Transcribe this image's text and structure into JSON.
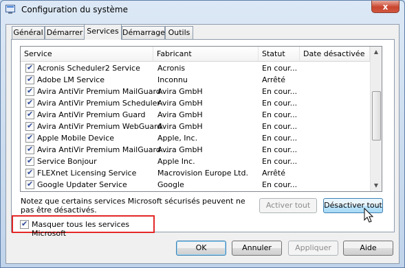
{
  "window": {
    "title": "Configuration du système",
    "close_label": "x"
  },
  "tabs": [
    {
      "label": "Général",
      "active": false
    },
    {
      "label": "Démarrer",
      "active": false
    },
    {
      "label": "Services",
      "active": true
    },
    {
      "label": "Démarrage",
      "active": false
    },
    {
      "label": "Outils",
      "active": false
    }
  ],
  "table": {
    "columns": [
      "Service",
      "Fabricant",
      "Statut",
      "Date désactivée"
    ],
    "rows": [
      {
        "checked": true,
        "service": "Acronis Scheduler2 Service",
        "fabricant": "Acronis",
        "statut": "En cour..."
      },
      {
        "checked": true,
        "service": "Adobe LM Service",
        "fabricant": "Inconnu",
        "statut": "Arrêté"
      },
      {
        "checked": true,
        "service": "Avira AntiVir Premium MailGuard",
        "fabricant": "Avira GmbH",
        "statut": "En cour..."
      },
      {
        "checked": true,
        "service": "Avira AntiVir Premium Scheduler",
        "fabricant": "Avira GmbH",
        "statut": "En cour..."
      },
      {
        "checked": true,
        "service": "Avira AntiVir Premium Guard",
        "fabricant": "Avira GmbH",
        "statut": "En cour..."
      },
      {
        "checked": true,
        "service": "Avira AntiVir Premium WebGuard",
        "fabricant": "Avira GmbH",
        "statut": "En cour..."
      },
      {
        "checked": true,
        "service": "Apple Mobile Device",
        "fabricant": "Apple, Inc.",
        "statut": "En cour..."
      },
      {
        "checked": true,
        "service": "Avira AntiVir Premium MailGuard ...",
        "fabricant": "Avira GmbH",
        "statut": "En cour..."
      },
      {
        "checked": true,
        "service": "Service Bonjour",
        "fabricant": "Apple Inc.",
        "statut": "En cour..."
      },
      {
        "checked": true,
        "service": "FLEXnet Licensing Service",
        "fabricant": "Macrovision Europe Ltd.",
        "statut": "Arrêté"
      },
      {
        "checked": true,
        "service": "Google Updater Service",
        "fabricant": "Google",
        "statut": "En cour..."
      }
    ]
  },
  "note": "Notez que certains services Microsoft sécurisés peuvent ne pas être désactivés.",
  "buttons": {
    "enable_all": "Activer tout",
    "disable_all": "Désactiver tout",
    "ok": "OK",
    "cancel": "Annuler",
    "apply": "Appliquer",
    "help": "Aide"
  },
  "hide_ms": {
    "label": "Masquer tous les services Microsoft",
    "checked": true
  }
}
